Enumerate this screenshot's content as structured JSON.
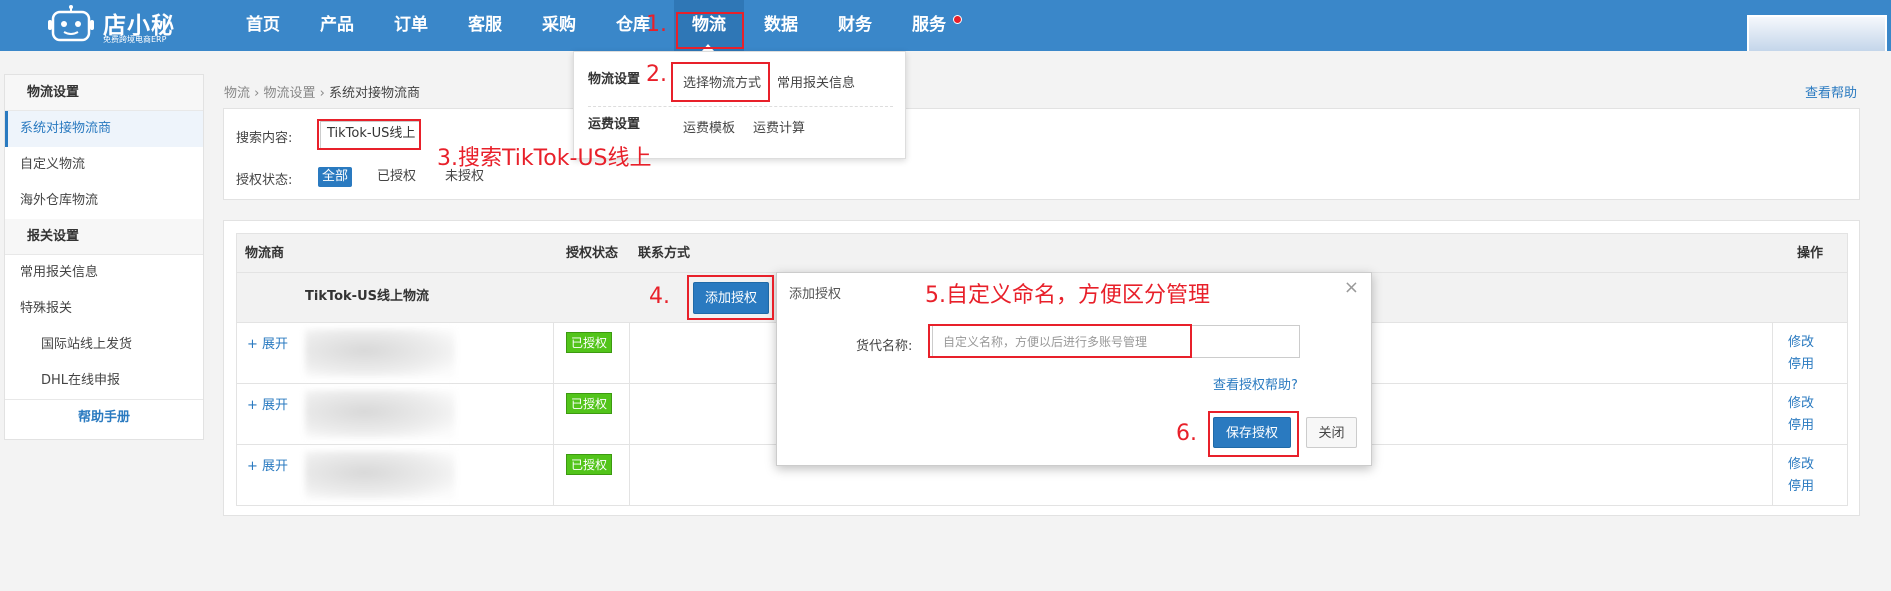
{
  "brand": {
    "name": "店小秘",
    "tagline": "免费跨境电商ERP"
  },
  "nav": {
    "items": [
      "首页",
      "产品",
      "订单",
      "客服",
      "采购",
      "仓库",
      "物流",
      "数据",
      "财务",
      "服务"
    ],
    "active": "物流"
  },
  "dropdown": {
    "logistics_settings": "物流设置",
    "select_method": "选择物流方式",
    "customs_info": "常用报关信息",
    "freight_settings": "运费设置",
    "freight_template": "运费模板",
    "freight_calc": "运费计算"
  },
  "sidebar": {
    "group1": "物流设置",
    "items1": [
      "系统对接物流商",
      "自定义物流",
      "海外仓库物流"
    ],
    "group2": "报关设置",
    "items2": [
      "常用报关信息",
      "特殊报关"
    ],
    "sub_items": [
      "国际站线上发货",
      "DHL在线申报"
    ],
    "help": "帮助手册"
  },
  "breadcrumb": {
    "l1": "物流",
    "l2": "物流设置",
    "current": "系统对接物流商"
  },
  "view_help": "查看帮助",
  "search": {
    "label": "搜索内容:",
    "value": "TikTok-US线上",
    "status_label": "授权状态:",
    "status_options": [
      "全部",
      "已授权",
      "未授权"
    ],
    "selected": "全部"
  },
  "table": {
    "headers": {
      "carrier": "物流商",
      "status": "授权状态",
      "contact": "联系方式",
      "ops": "操作"
    },
    "group_name": "TikTok-US线上物流",
    "add_button": "添加授权",
    "rows": [
      {
        "expand": "+ 展开",
        "status": "已授权",
        "edit": "修改",
        "disable": "停用"
      },
      {
        "expand": "+ 展开",
        "status": "已授权",
        "edit": "修改",
        "disable": "停用"
      },
      {
        "expand": "+ 展开",
        "status": "已授权",
        "edit": "修改",
        "disable": "停用"
      }
    ]
  },
  "modal": {
    "title": "添加授权",
    "field_label": "货代名称:",
    "placeholder": "自定义名称，方便以后进行多账号管理",
    "help_link": "查看授权帮助?",
    "save": "保存授权",
    "close": "关闭",
    "close_icon": "×"
  },
  "annotations": {
    "a1": "1.",
    "a2": "2.",
    "a3": "3.搜索TikTok-US线上",
    "a4": "4.",
    "a5": "5.自定义命名，方便区分管理",
    "a6": "6."
  },
  "colors": {
    "primary": "#2a7ac0",
    "topbar": "#3a87c9",
    "badge": "#52c41a",
    "annotation": "#e8202a"
  }
}
